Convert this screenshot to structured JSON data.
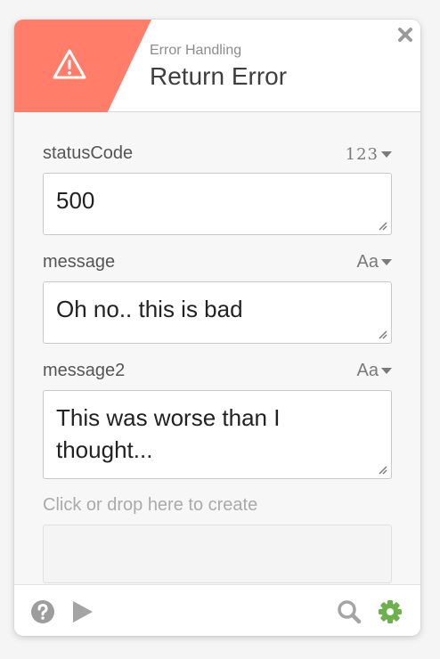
{
  "header": {
    "category": "Error Handling",
    "title": "Return Error",
    "icon": "warning-icon",
    "accent_color": "#ff7d69"
  },
  "fields": [
    {
      "label": "statusCode",
      "type": "123",
      "value": "500"
    },
    {
      "label": "message",
      "type": "Aa",
      "value": "Oh no.. this is bad"
    },
    {
      "label": "message2",
      "type": "Aa",
      "value": "This was worse than I thought..."
    }
  ],
  "create": {
    "label": "Click or drop here to create"
  },
  "footer": {
    "left_icons": [
      "help-icon",
      "play-icon"
    ],
    "right_icons": [
      "search-icon",
      "gear-icon"
    ],
    "gear_color": "#6cb24a"
  }
}
